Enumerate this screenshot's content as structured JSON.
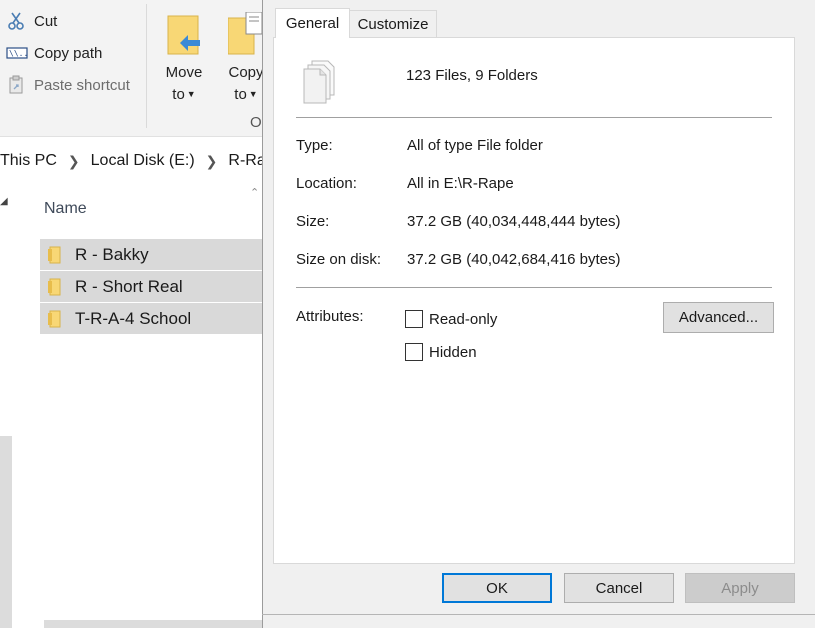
{
  "ribbon": {
    "cut_label": "Cut",
    "copy_path_label": "Copy path",
    "paste_shortcut_label": "Paste shortcut",
    "move_to_label_line1": "Move",
    "move_to_label_line2": "to",
    "copy_to_label_line1": "Copy",
    "copy_to_label_line2": "to",
    "group_label_partial": "O"
  },
  "address_bar": {
    "crumbs": [
      "This PC",
      "Local Disk (E:)",
      "R-Ra"
    ]
  },
  "file_list": {
    "column_name": "Name",
    "rows": [
      {
        "name": "R - Bakky"
      },
      {
        "name": "R - Short Real"
      },
      {
        "name": "T-R-A-4 School"
      }
    ]
  },
  "dialog": {
    "tabs": [
      "General",
      "Customize"
    ],
    "active_tab": "General",
    "summary": "123 Files, 9 Folders",
    "properties": [
      {
        "label": "Type:",
        "value": "All of type File folder"
      },
      {
        "label": "Location:",
        "value": "All in E:\\R-Rape"
      },
      {
        "label": "Size:",
        "value": "37.2 GB (40,034,448,444 bytes)"
      },
      {
        "label": "Size on disk:",
        "value": "37.2 GB (40,042,684,416 bytes)"
      }
    ],
    "attributes_label": "Attributes:",
    "read_only_label": "Read-only",
    "hidden_label": "Hidden",
    "advanced_label": "Advanced...",
    "ok_label": "OK",
    "cancel_label": "Cancel",
    "apply_label": "Apply"
  },
  "colors": {
    "selection": "#d9d9d9",
    "accent": "#0078d7",
    "folder": "#f8d775"
  }
}
